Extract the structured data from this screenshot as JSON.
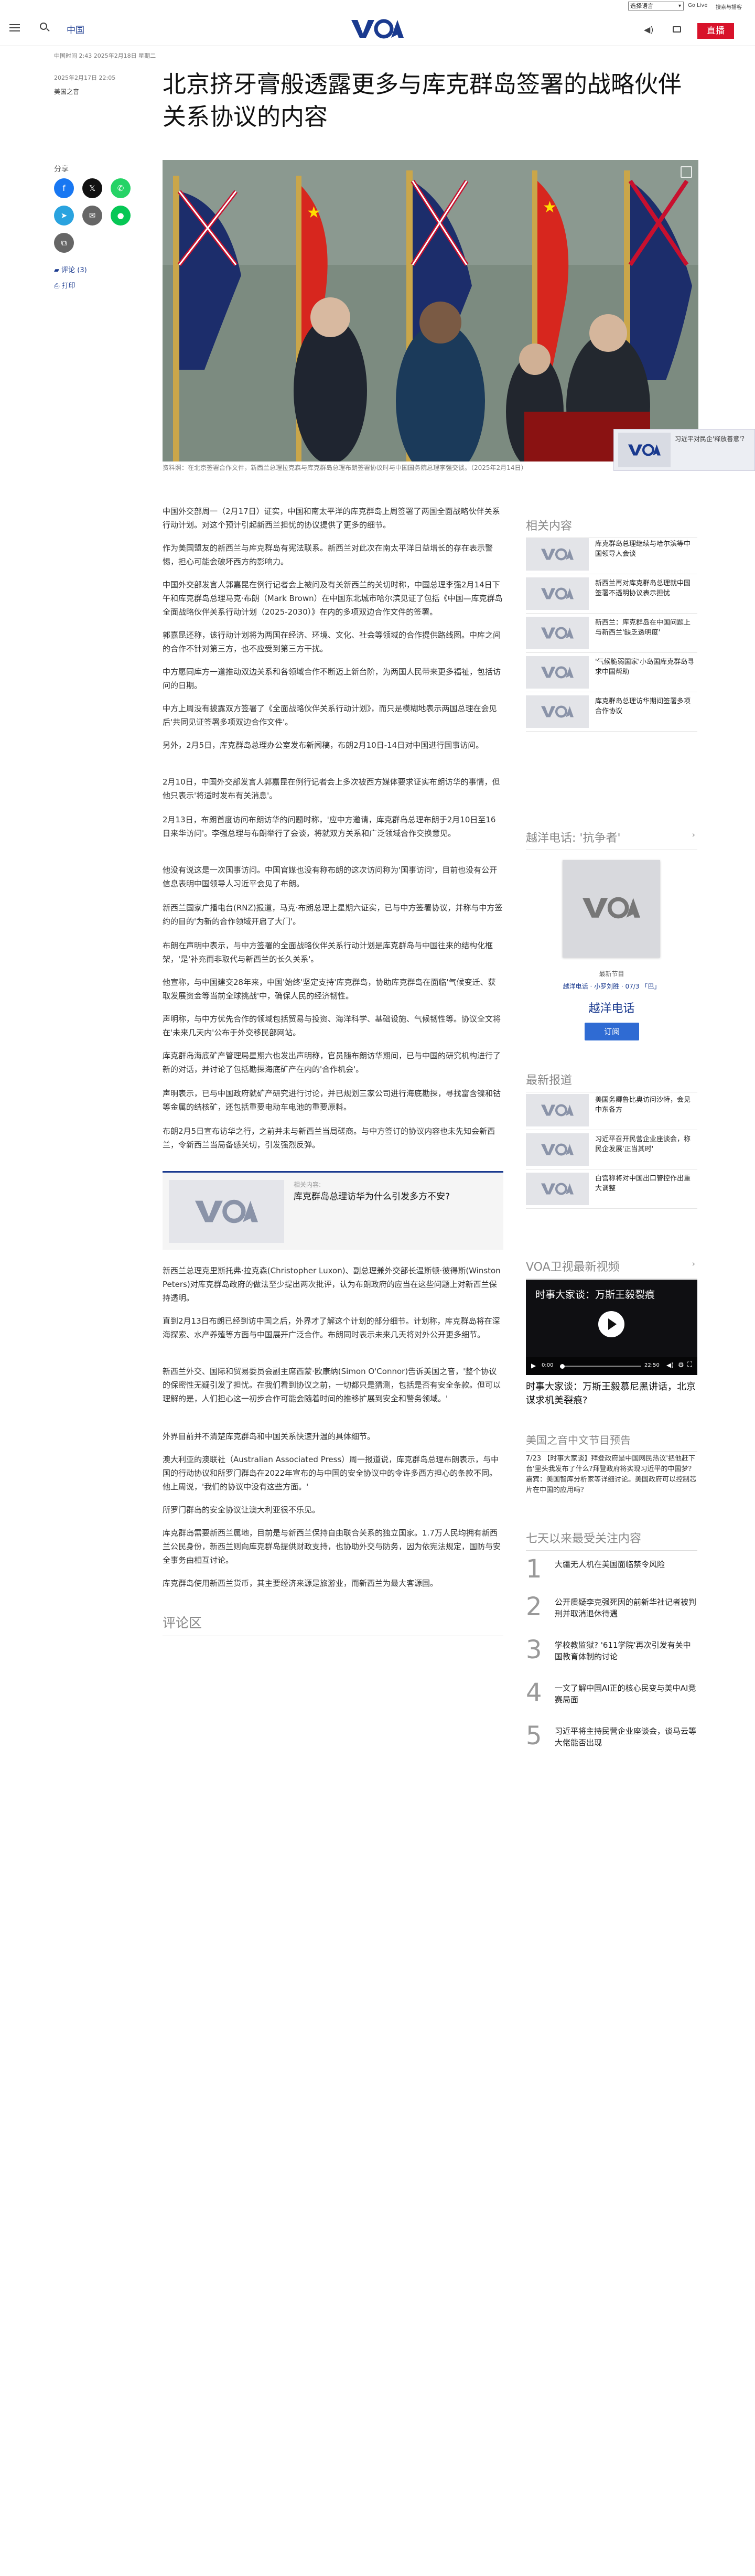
{
  "utility": {
    "language_select": "选择语言",
    "link1": "Go Live",
    "link2": "搜索与播客"
  },
  "header": {
    "section": "中国",
    "logo": "VOA",
    "live_label": "直播"
  },
  "article": {
    "dateline": "中国时间 2:43 2025年2月18日 星期二",
    "date": "2025年2月17日 22:05",
    "author": "美国之音",
    "title": "北京挤牙膏般透露更多与库克群岛签署的战略伙伴关系协议的内容",
    "share_label": "分享",
    "comments_link": "评论 (3)",
    "print_link": "打印",
    "caption": "资料照：在北京签署合作文件，新西兰总理拉克森与库克群岛总理布朗签署协议时与中国国务院总理李强交谈。（2025年2月14日）",
    "paragraphs": [
      "中国外交部周一（2月17日）证实，中国和南太平洋的库克群岛上周签署了两国全面战略伙伴关系行动计划。对这个预计引起新西兰担忧的协议提供了更多的细节。",
      "作为美国盟友的新西兰与库克群岛有宪法联系。新西兰对此次在南太平洋日益增长的存在表示警惕，担心可能会破坏西方的影响力。",
      "中国外交部发言人郭嘉昆在例行记者会上被问及有关新西兰的关切时称，中国总理李强2月14日下午和库克群岛总理马克·布朗（Mark Brown）在中国东北城市哈尔滨见证了包括《中国—库克群岛全面战略伙伴关系行动计划（2025-2030）》在内的多项双边合作文件的签署。",
      "郭嘉昆还称，该行动计划将为两国在经济、环境、文化、社会等领域的合作提供路线图。中库之间的合作不针对第三方，也不应受到第三方干扰。",
      "中方愿同库方一道推动双边关系和各领域合作不断迈上新台阶，为两国人民带来更多福祉，包括访问的日期。",
      "中方上周没有披露双方签署了《全面战略伙伴关系行动计划》，而只是模糊地表示两国总理在会见后'共同见证签署多项双边合作文件'。",
      "另外，2月5日，库克群岛总理办公室发布新闻稿，布朗2月10日-14日对中国进行国事访问。",
      "2月10日，中国外交部发言人郭嘉昆在例行记者会上多次被西方媒体要求证实布朗访华的事情，但他只表示'将适时发布有关消息'。",
      "2月13日，布朗首度访问布朗访华的问题时称，'应中方邀请，库克群岛总理布朗于2月10日至16日来华访问'。李强总理与布朗举行了会谈，将就双方关系和广泛领域合作交换意见。",
      "他没有说这是一次国事访问。中国官媒也没有称布朗的这次访问称为'国事访问'，目前也没有公开信息表明中国领导人习近平会见了布朗。",
      "新西兰国家广播电台(RNZ)报道，马克·布朗总理上星期六证实，已与中方签署协议，并称与中方签约的目的'为新的合作领域开启了大门'。",
      "布朗在声明中表示，与中方签署的全面战略伙伴关系行动计划是库克群岛与中国往来的结构化框架，'是'补充而非取代与新西兰的长久关系'。",
      "他宣称，与中国建交28年来，中国'始终'坚定支持'库克群岛，协助库克群岛在面临'气候变迁、获取发展资金等当前全球挑战'中，确保人民的经济韧性。",
      "声明称，与中方优先合作的领域包括贸易与投资、海洋科学、基础设施、气候韧性等。协议全文将在'未来几天内'公布于外交移民部网站。",
      "库克群岛海底矿产管理局星期六也发出声明称，官员随布朗访华期间，已与中国的研究机构进行了新的对话，并讨论了包括勘探海底矿产在内的'合作机会'。",
      "声明表示，已与中国政府就矿产研究进行讨论，并已规划三家公司进行海底勘探，寻找富含镍和钴等金属的结核矿，还包括重要电动车电池的重要原料。",
      "布朗2月5日宣布访华之行，之前并未与新西兰当局磋商。与中方签订的协议内容也未先知会新西兰，令新西兰当局备感关切，引发强烈反弹。"
    ],
    "related_label": "相关内容:",
    "related_title": "库克群岛总理访华为什么引发多方不安?",
    "paragraphs2": [
      "新西兰总理克里斯托弗·拉克森(Christopher Luxon)、副总理兼外交部长温斯顿·彼得斯(Winston Peters)对库克群岛政府的做法至少提出两次批评，认为布朗政府的应当在这些问题上对新西兰保持透明。",
      "直到2月13日布朗已经到访中国之后，外界才了解这个计划的部分细节。计划称，库克群岛将在深海探索、水产养殖等方面与中国展开广泛合作。布朗同时表示未来几天将对外公开更多细节。",
      "新西兰外交、国际和贸易委员会副主席西蒙·欧康纳(Simon O'Connor)告诉美国之音，'整个协议的保密性无疑引发了担忧。在我们看到协议之前，一切都只是猜测，包括是否有安全条款。但可以理解的是，人们担心这一初步合作可能会随着时间的推移扩展到安全和警务领域。'",
      "外界目前并不清楚库克群岛和中国关系快速升温的具体细节。",
      "澳大利亚的澳联社（Australian Associated Press）周一报道说，库克群岛总理布朗表示，与中国的行动协议和所罗门群岛在2022年宣布的与中国的安全协议中的令许多西方担心的条款不同。他上周说，'我们的协议中没有这些方面。'",
      "所罗门群岛的安全协议让澳大利亚很不乐见。",
      "库克群岛需要新西兰属地，目前是与新西兰保持自由联合关系的独立国家。1.7万人民均拥有新西兰公民身份，新西兰则向库克群岛提供财政支持，也协助外交与防务，因为依宪法规定，国防与安全事务由相互讨论。",
      "库克群岛使用新西兰货币，其主要经济来源是旅游业，而新西兰为最大客源国。"
    ],
    "comments_heading": "评论区"
  },
  "popup": {
    "text": "习近平对民企'释放善意'？"
  },
  "sidebar": {
    "related_heading": "相关内容",
    "related": [
      "库克群岛总理继续与哈尔滨等中国领导人会谈",
      "新西兰再对库克群岛总理就中国签署不透明协议表示担忧",
      "新西兰：库克群岛在中国问题上与新西兰'缺乏透明度'",
      "'气候脆弱国家'小岛国库克群岛寻求中国帮助",
      "库克群岛总理访华期间签署多项合作协议"
    ],
    "hotline_heading": "越洋电话: '抗争者'",
    "hotline_episode": "最新节目",
    "hotline_links": "越洋电话 · 小罗刘胜 · 07/3 「巴」",
    "hotline_name": "越洋电话",
    "subscribe": "订阅",
    "latest_heading": "最新报道",
    "latest": [
      "美国务卿鲁比奥访问沙特，会见中东各方",
      "习近平召开民营企业座谈会，称民企发展'正当其时'",
      "白宫称将对中国出口管控作出重大调整"
    ],
    "tv_heading": "VOA卫视最新视频",
    "video_title": "时事大家谈：万斯王毅裂痕",
    "video_time": "0:00",
    "video_duration": "22:50",
    "video_caption": "时事大家谈：万斯王毅慕尼黑讲话，北京谋求机美裂痕?",
    "program_heading": "美国之音中文节目预告",
    "program_text": "7/23 【时事大家谈】拜登政府是中国网民热议'把他赶下台'里头我发布了什么?拜登政府将实现习近平的中国梦？嘉宾：美国智库分析家等详细讨论。美国政府可以控制芯片在中国的应用吗？",
    "top_heading": "七天以来最受关注内容",
    "top": [
      "大疆无人机在美国面临禁令风险",
      "公开质疑李克强死因的前新华社记者被判刑并取消退休待遇",
      "学校教监狱? '611学院'再次引发有关中国教育体制的讨论",
      "一文了解中国AI正的核心民变与美中AI竞赛局面",
      "习近平将主持民营企业座谈会，谈马云等大佬能否出现"
    ]
  },
  "colors": {
    "brand_blue": "#1a3a8f",
    "live_red": "#d8122a"
  }
}
